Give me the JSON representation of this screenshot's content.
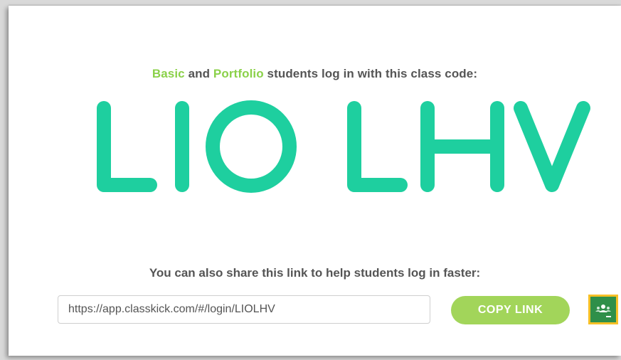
{
  "headline": {
    "basic": "Basic",
    "and": " and ",
    "portfolio": "Portfolio",
    "rest": " students log in with this class code:"
  },
  "class_code": {
    "letters": [
      "L",
      "I",
      "O",
      "L",
      "H",
      "V"
    ],
    "color": "#1ecf9f"
  },
  "share": {
    "text": "You can also share this link to help students log in faster:",
    "link": "https://app.classkick.com/#/login/LIOLHV",
    "copy_label": "COPY LINK"
  },
  "classroom_icon": "google-classroom-icon",
  "colors": {
    "accent_green": "#8bd14a",
    "button_green": "#a2d55a",
    "code_teal": "#1ecf9f",
    "text_gray": "#555555",
    "classroom_border": "#f6c026",
    "classroom_bg": "#2f8f49"
  }
}
